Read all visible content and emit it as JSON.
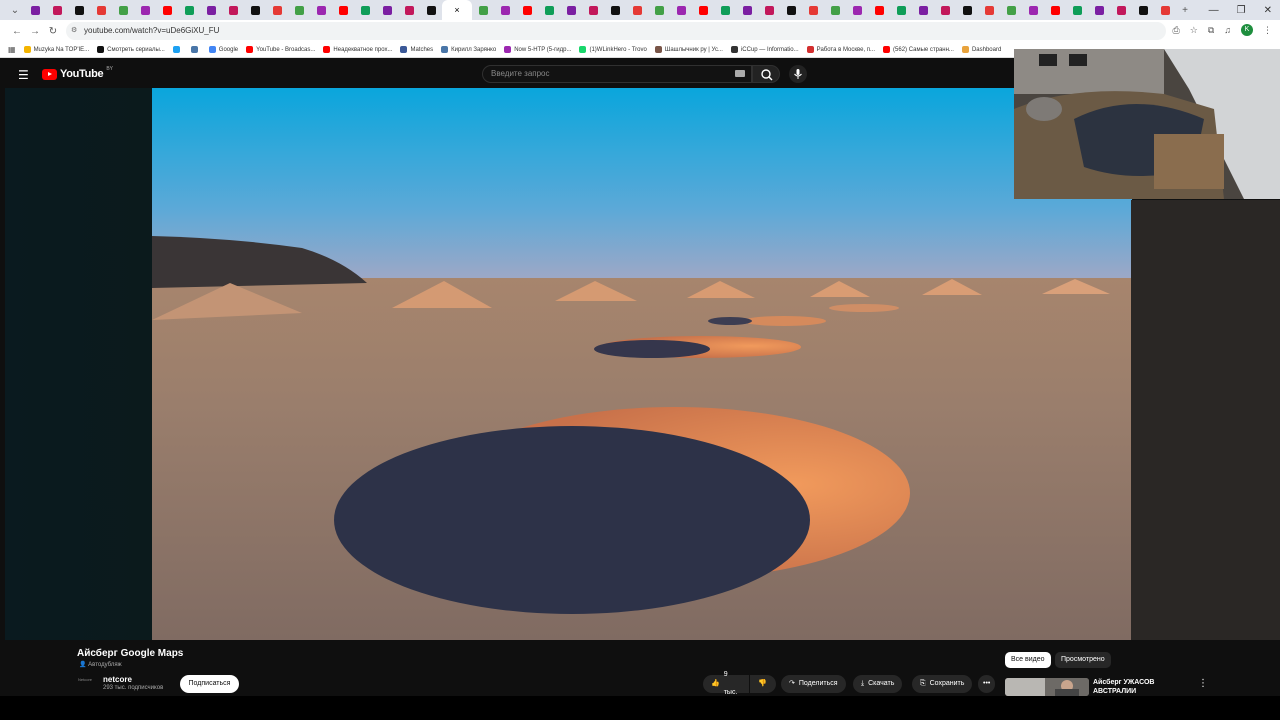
{
  "browser": {
    "tabs_count": 52,
    "url": "youtube.com/watch?v=uDe6GiXU_FU",
    "profile_initial": "K",
    "bookmarks": [
      {
        "label": "Muzyka Na TOP'IE...",
        "color": "#f4b400"
      },
      {
        "label": "Смотреть сериалы...",
        "color": "#111111"
      },
      {
        "label": "",
        "color": "#1da1f2"
      },
      {
        "label": "",
        "color": "#4a76a8"
      },
      {
        "label": "Google",
        "color": "#4285f4"
      },
      {
        "label": "YouTube - Broadcas...",
        "color": "#ff0000"
      },
      {
        "label": "Неадекватное прох...",
        "color": "#ff0000"
      },
      {
        "label": "Matches",
        "color": "#3b5998"
      },
      {
        "label": "Кирилл Зарянко",
        "color": "#4a76a8"
      },
      {
        "label": "Now 5-HTP (5-гидр...",
        "color": "#9c27b0"
      },
      {
        "label": "(1)WLinkHero - Trovo",
        "color": "#19d66b"
      },
      {
        "label": "Шашлычник ру | Ус...",
        "color": "#795548"
      },
      {
        "label": "iCCup — Informatio...",
        "color": "#333333"
      },
      {
        "label": "Работа в Москве, п...",
        "color": "#d32f2f"
      },
      {
        "label": "(562) Самые странн...",
        "color": "#ff0000"
      },
      {
        "label": "Dashboard",
        "color": "#e8a33d"
      }
    ]
  },
  "youtube": {
    "logo_text": "YouTube",
    "region": "BY",
    "search_placeholder": "Введите запрос",
    "video_title": "Айсберг Google Maps",
    "autodub_label": "Автодубляж",
    "channel_avatar_text": "Netcore",
    "channel_name": "netcore",
    "subscribers": "293 тыс. подписчиков",
    "subscribe_label": "Подписаться",
    "likes": "9 тыс.",
    "share_label": "Поделиться",
    "download_label": "Скачать",
    "save_label": "Сохранить",
    "more_label": "•••",
    "chip_all": "Все видео",
    "chip_watched": "Просмотрено",
    "rec_title": "Айсберг УЖАСОВ АВСТРАЛИИ"
  }
}
